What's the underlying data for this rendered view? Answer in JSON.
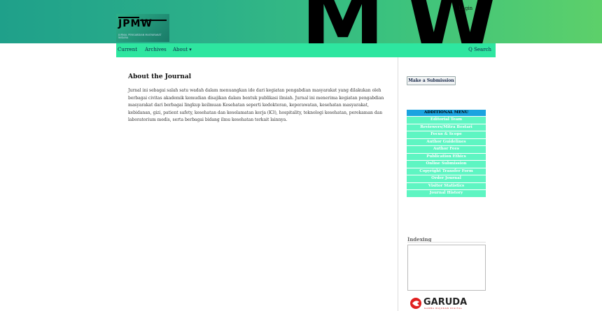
{
  "header": {
    "login_label": "Login",
    "logo_text": "JPMW",
    "logo_subtitle": "JURNAL PENGABDIAN MASYARAKAT WIDARA"
  },
  "nav": {
    "items": [
      {
        "label": "Current"
      },
      {
        "label": "Archives"
      },
      {
        "label": "About ▾"
      }
    ],
    "search_label": "Q Search"
  },
  "main": {
    "title": "About the Journal",
    "body": "Jurnal ini sebagai salah satu wadah dalam menuangkan ide dari kegiatan pengabdian masyarakat yang dilakukan oleh berbagai civitas akademik kemudian disajikan dalam bentuk publikasi ilmiah. Jurnal ini menerima kegiatan pengabdian masyarakat dari berbagai lingkup keilmuan Kesehatan seperti kedokteran, keperawatan, kesehatan masyarakat, kebidanan, gizi, patient safety, kesehatan dan keselamatan kerja (K3), hospitality, teknologi kesehatan, perekaman dan laboratorium medis, serta berbagai bidang ilmu kesehatan terkait lainnya."
  },
  "sidebar": {
    "submit_label": "Make a Submission",
    "menu_title": "ADDITIONAL MENU",
    "menu_items": [
      {
        "label": "Editorial Team"
      },
      {
        "label": "Reviewers/Mitra Bestari"
      },
      {
        "label": "Focus & Scope"
      },
      {
        "label": "Author Guidelines"
      },
      {
        "label": "Author Fees"
      },
      {
        "label": "Publication Ethics"
      },
      {
        "label": "Online Submission"
      },
      {
        "label": "Copyright Transfer Form"
      },
      {
        "label": "Order Journal"
      },
      {
        "label": "Visitor Statistics"
      },
      {
        "label": "Journal History"
      }
    ],
    "indexing_title": "Indexing",
    "garuda_label": "GARUDA",
    "garuda_subtitle": "GARBA RUJUKAN DIGITAL"
  }
}
